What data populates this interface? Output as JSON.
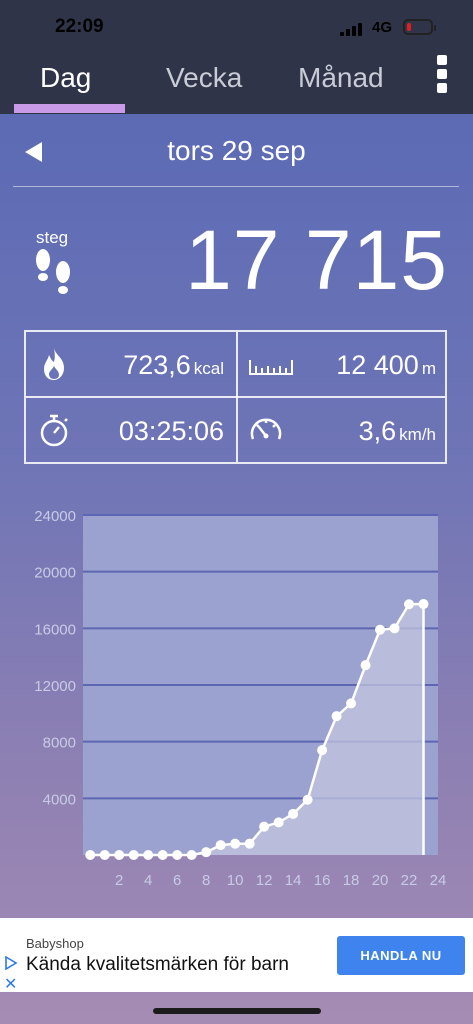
{
  "status_bar": {
    "time": "22:09",
    "network": "4G"
  },
  "tabs": [
    {
      "label": "Dag",
      "active": true
    },
    {
      "label": "Vecka",
      "active": false
    },
    {
      "label": "Månad",
      "active": false
    }
  ],
  "date": "tors 29 sep",
  "steps": {
    "label": "steg",
    "value": "17 715"
  },
  "stats": {
    "calories": {
      "value": "723,6",
      "unit": "kcal"
    },
    "distance": {
      "value": "12 400",
      "unit": "m"
    },
    "duration": {
      "value": "03:25:06",
      "unit": ""
    },
    "speed": {
      "value": "3,6",
      "unit": "km/h"
    }
  },
  "chart_data": {
    "type": "area",
    "title": "",
    "xlabel": "",
    "ylabel": "",
    "x": [
      0,
      1,
      2,
      3,
      4,
      5,
      6,
      7,
      8,
      9,
      10,
      11,
      12,
      13,
      14,
      15,
      16,
      17,
      18,
      19,
      20,
      21,
      22,
      23
    ],
    "values": [
      0,
      0,
      0,
      0,
      0,
      0,
      0,
      0,
      200,
      700,
      800,
      800,
      2000,
      2300,
      2900,
      3900,
      7400,
      9800,
      10700,
      13400,
      15900,
      16000,
      17700,
      17715
    ],
    "xticks": [
      "2",
      "4",
      "6",
      "8",
      "10",
      "12",
      "14",
      "16",
      "18",
      "20",
      "22",
      "24"
    ],
    "yticks": [
      "4000",
      "8000",
      "12000",
      "16000",
      "20000",
      "24000"
    ],
    "xlim": [
      -0.5,
      24
    ],
    "ylim": [
      0,
      24000
    ],
    "grid": true,
    "colors": {
      "line": "#ffffff",
      "fill": "#c3c6df",
      "plot_bg": "#9ba2cf",
      "grid": "#5d66b3"
    }
  },
  "ad": {
    "brand": "Babyshop",
    "title": "Kända kvalitetsmärken för barn",
    "button": "HANDLA NU"
  }
}
